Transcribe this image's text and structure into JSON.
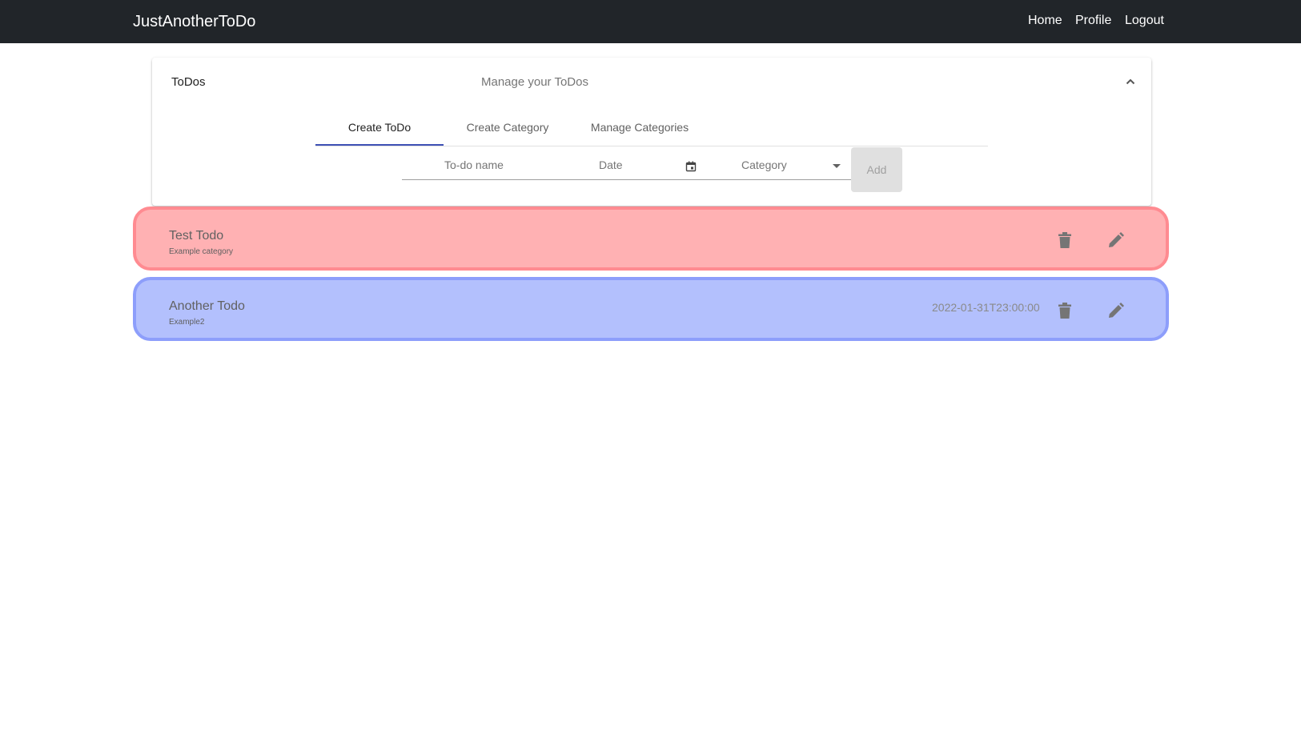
{
  "navbar": {
    "brand": "JustAnotherToDo",
    "links": [
      "Home",
      "Profile",
      "Logout"
    ]
  },
  "panel": {
    "title": "ToDos",
    "description": "Manage your ToDos",
    "tabs": [
      {
        "label": "Create ToDo",
        "active": true
      },
      {
        "label": "Create Category",
        "active": false
      },
      {
        "label": "Manage Categories",
        "active": false
      }
    ],
    "form": {
      "name_placeholder": "To-do name",
      "date_placeholder": "Date",
      "category_placeholder": "Category",
      "add_label": "Add"
    }
  },
  "todos": [
    {
      "name": "Test Todo",
      "category": "Example category",
      "date": "",
      "bg": "#ffb1b3",
      "border": "#ff8b91"
    },
    {
      "name": "Another Todo",
      "category": "Example2",
      "date": "2022-01-31T23:00:00",
      "bg": "#b3c0fd",
      "border": "#8d9efb"
    }
  ],
  "colors": {
    "accent": "#3f51b5",
    "navbar": "#212529"
  }
}
